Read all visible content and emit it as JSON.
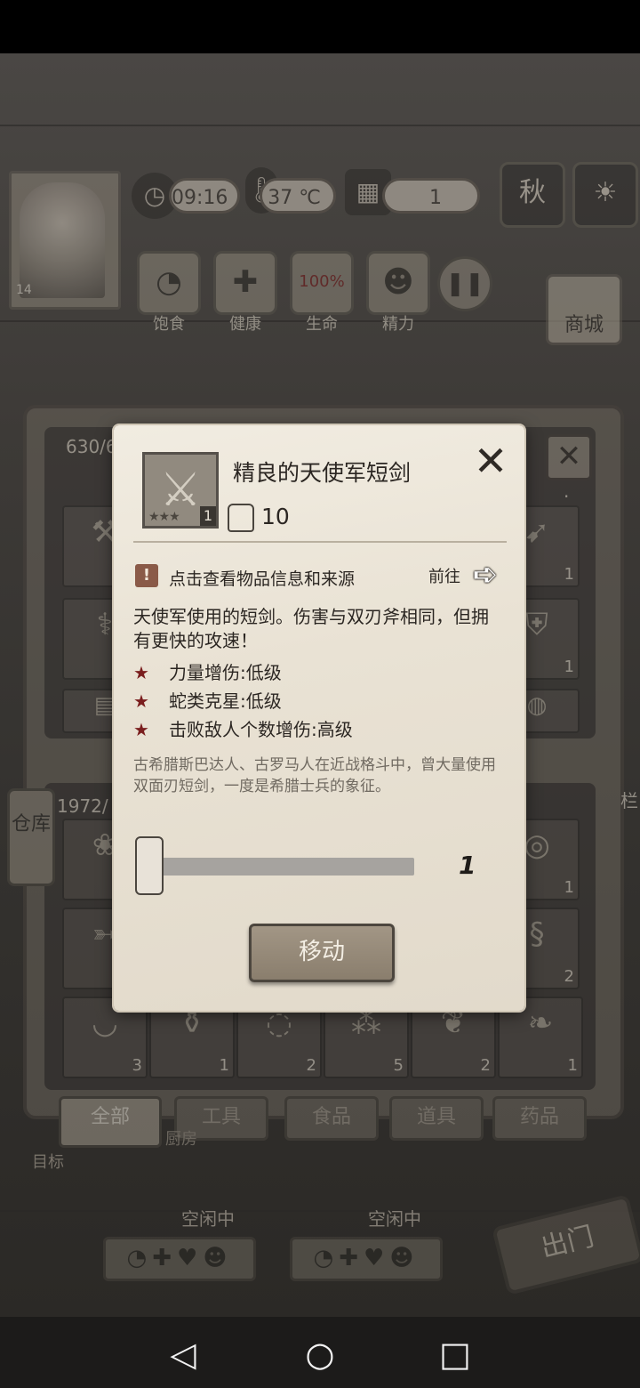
{
  "hud": {
    "time": "09:16",
    "temperature": "37 ℃",
    "day": "1",
    "level": "14",
    "season": "秋",
    "stats": [
      "饱食",
      "健康",
      "生命",
      "精力"
    ],
    "life_value": "100%",
    "shop_label": "商城"
  },
  "inventory": {
    "top_count": "630/6",
    "bottom_count": "1972/",
    "side_tab": "仓库",
    "right_label": "栏",
    "right_mark": ".",
    "top_slots": [
      {
        "icon": "axe-icon",
        "count": ""
      },
      {
        "icon": "bow-icon",
        "count": "1"
      },
      {
        "icon": "bandage-icon",
        "count": ""
      },
      {
        "icon": "vest-icon",
        "count": "1"
      },
      {
        "icon": "cloth-icon",
        "count": ""
      },
      {
        "icon": "shield-icon",
        "count": ""
      }
    ],
    "bottom_slots": [
      {
        "icon": "fruit-icon",
        "count": ""
      },
      {
        "icon": "nest-icon",
        "count": "1"
      },
      {
        "icon": "fish-icon",
        "count": ""
      },
      {
        "icon": "rope-icon",
        "count": "2"
      },
      {
        "icon": "bowl-icon",
        "count": "3"
      },
      {
        "icon": "jar-icon",
        "count": "1"
      },
      {
        "icon": "pills-icon",
        "count": "2"
      },
      {
        "icon": "nuts-icon",
        "count": "5"
      },
      {
        "icon": "herb-icon",
        "count": "2"
      },
      {
        "icon": "leaf-icon",
        "count": "1"
      }
    ],
    "tabs": [
      "全部",
      "工具",
      "食品",
      "道具",
      "药品"
    ],
    "kitchen_label": "厨房",
    "goal_label": "目标"
  },
  "workers": [
    {
      "status": "空闲中"
    },
    {
      "status": "空闲中"
    }
  ],
  "go_out_label": "出门",
  "modal": {
    "item_name": "精良的天使军短剑",
    "item_stars": "★★★",
    "item_count": "1",
    "weight": "10",
    "info_text": "点击查看物品信息和来源",
    "goto_text": "前往",
    "description": "天使军使用的短剑。伤害与双刃斧相同，但拥有更快的攻速！",
    "attributes": [
      {
        "star": "★",
        "text": "力量增伤:低级"
      },
      {
        "star": "★",
        "text": "蛇类克星:低级"
      },
      {
        "star": "★",
        "text": "击败敌人个数增伤:高级"
      }
    ],
    "lore": "古希腊斯巴达人、古罗马人在近战格斗中，曾大量使用双面刃短剑，一度是希腊士兵的象征。",
    "slider_value": "1",
    "move_button": "移动"
  }
}
